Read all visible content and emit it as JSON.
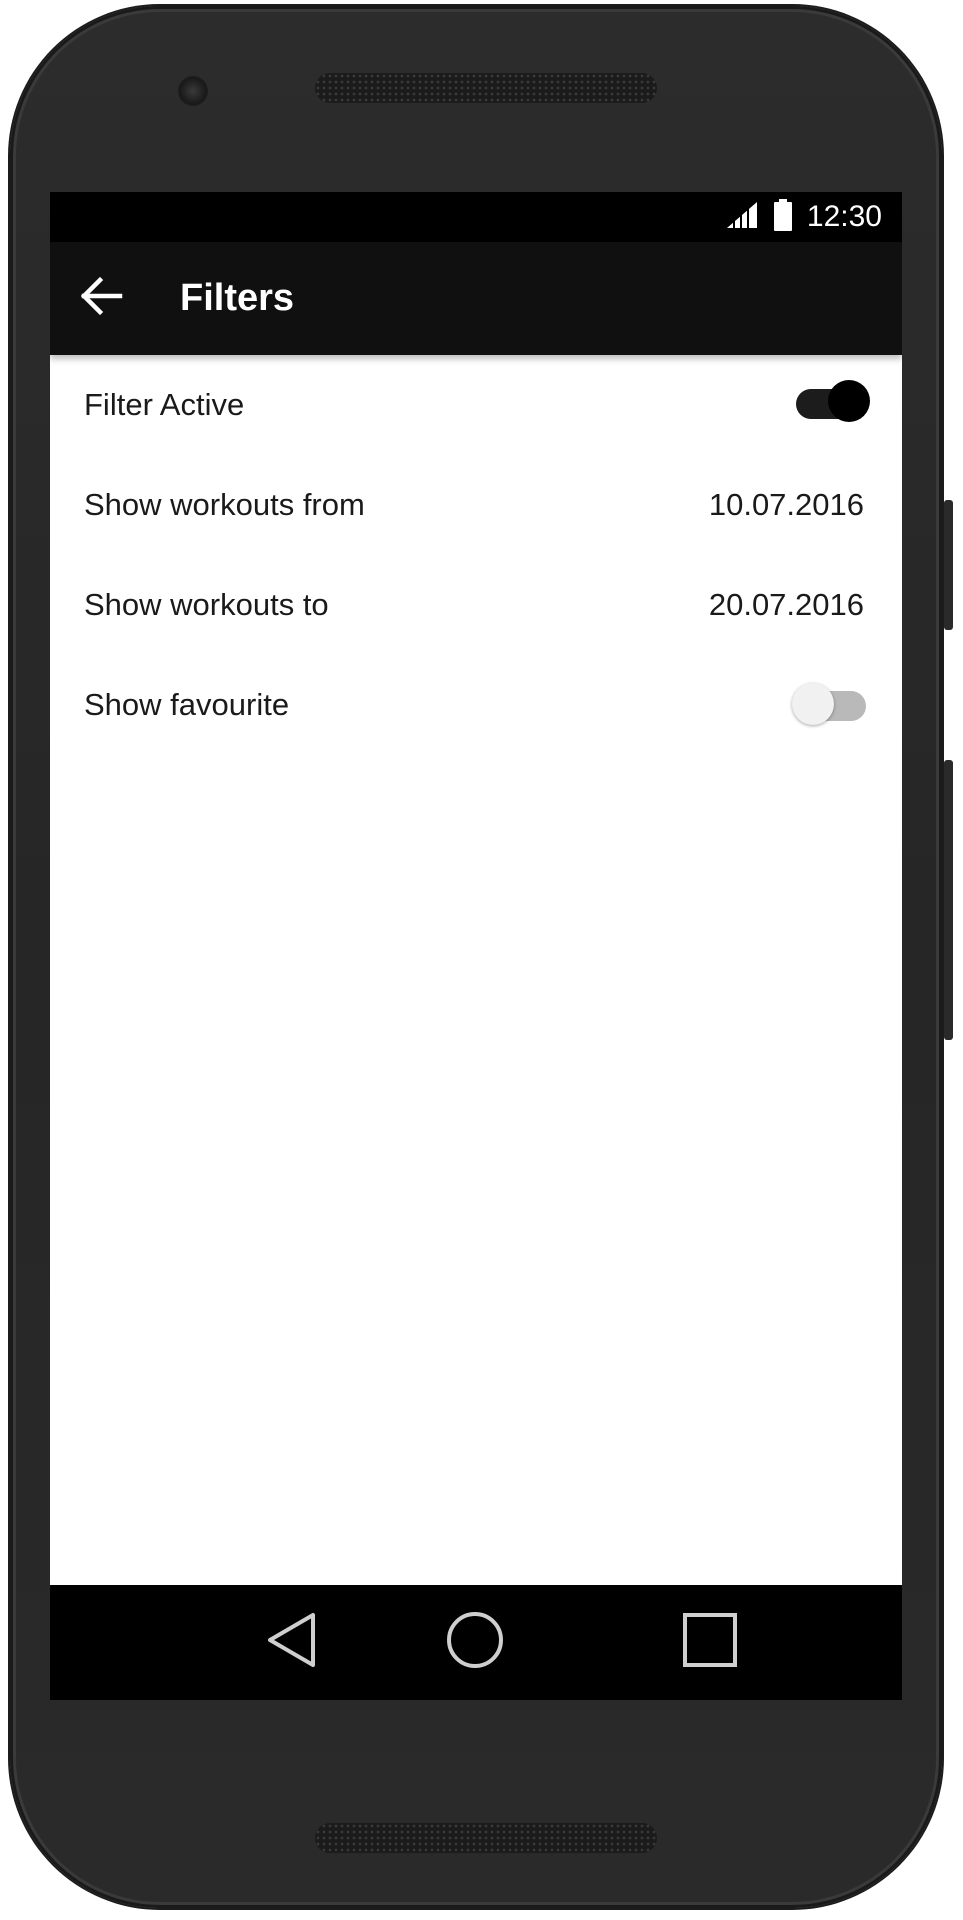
{
  "status_bar": {
    "time": "12:30",
    "signal_icon": "cell-signal-icon",
    "battery_icon": "battery-icon"
  },
  "app_bar": {
    "title": "Filters",
    "back_icon": "arrow-back-icon"
  },
  "filters": {
    "filter_active": {
      "label": "Filter Active",
      "enabled": true
    },
    "from": {
      "label": "Show workouts from",
      "value": "10.07.2016"
    },
    "to": {
      "label": "Show workouts to",
      "value": "20.07.2016"
    },
    "favourite": {
      "label": "Show favourite",
      "enabled": false
    }
  },
  "nav_bar": {
    "back_icon": "nav-back-triangle-icon",
    "home_icon": "nav-home-circle-icon",
    "recents_icon": "nav-recents-square-icon"
  },
  "colors": {
    "app_bar": "#101010",
    "status_bar": "#000000",
    "switch_on": "#000000",
    "switch_off_track": "#b9b9b9"
  }
}
